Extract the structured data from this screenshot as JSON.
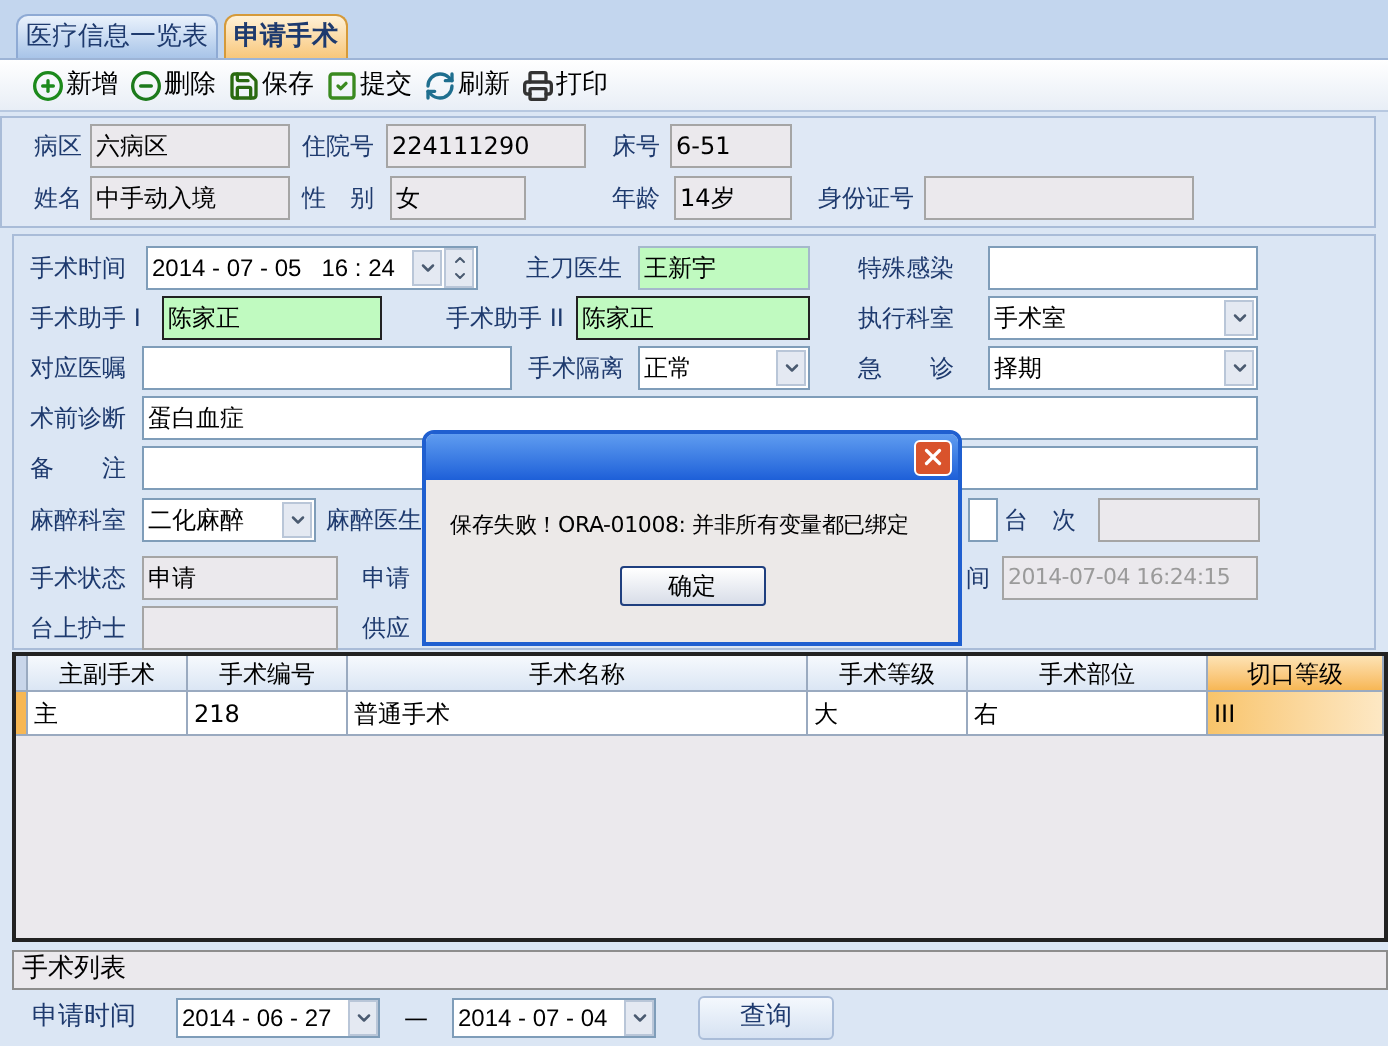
{
  "tabs": [
    {
      "label": "医疗信息一览表",
      "selected": false
    },
    {
      "label": "申请手术",
      "selected": true
    }
  ],
  "toolbar": [
    {
      "kind": "add",
      "label": "新增"
    },
    {
      "kind": "delete",
      "label": "删除"
    },
    {
      "kind": "save",
      "label": "保存"
    },
    {
      "kind": "submit",
      "label": "提交"
    },
    {
      "kind": "refresh",
      "label": "刷新"
    },
    {
      "kind": "print",
      "label": "打印"
    }
  ],
  "patient_info": [
    [
      {
        "kind": "label",
        "text": "病区"
      },
      {
        "kind": "text",
        "value": "六病区",
        "readonly": true
      },
      {
        "kind": "label",
        "text": "住院号"
      },
      {
        "kind": "text",
        "value": "224111290",
        "readonly": true
      },
      {
        "kind": "label",
        "text": "床号"
      },
      {
        "kind": "text",
        "value": "6-51",
        "readonly": true
      }
    ],
    [
      {
        "kind": "label",
        "text": "姓名"
      },
      {
        "kind": "text",
        "value": "中手动入境",
        "readonly": true
      },
      {
        "kind": "label",
        "text": "性　别"
      },
      {
        "kind": "text",
        "value": "女",
        "readonly": true
      },
      {
        "kind": "label",
        "text": "年龄"
      },
      {
        "kind": "text",
        "value": "14岁",
        "readonly": true
      },
      {
        "kind": "label",
        "text": "身份证号"
      },
      {
        "kind": "text",
        "readonly": true
      }
    ]
  ],
  "surgery_form": [
    [
      {
        "kind": "label",
        "text": "手术时间"
      },
      {
        "kind": "datetime",
        "value": "2014 - 07 - 05   16 : 24"
      },
      {
        "kind": "label",
        "text": "主刀医生"
      },
      {
        "kind": "text",
        "value": "王新宇",
        "highlight": true
      },
      {
        "kind": "label",
        "text": "特殊感染"
      },
      {
        "kind": "text"
      }
    ],
    [
      {
        "kind": "label",
        "text": "手术助手 I"
      },
      {
        "kind": "picker",
        "value": "陈家正",
        "highlight": true
      },
      {
        "kind": "label",
        "text": "手术助手 II"
      },
      {
        "kind": "picker",
        "value": "陈家正",
        "highlight": true
      },
      {
        "kind": "label",
        "text": "执行科室"
      },
      {
        "kind": "select",
        "value": "手术室"
      }
    ],
    [
      {
        "kind": "label",
        "text": "对应医嘱"
      },
      {
        "kind": "text"
      },
      {
        "kind": "label",
        "text": "手术隔离"
      },
      {
        "kind": "select",
        "value": "正常"
      },
      {
        "kind": "label",
        "text": "急　　诊"
      },
      {
        "kind": "select",
        "value": "择期"
      }
    ],
    [
      {
        "kind": "label",
        "text": "术前诊断"
      },
      {
        "kind": "text",
        "value": "蛋白血症"
      }
    ],
    [
      {
        "kind": "label",
        "text": "备　　注"
      },
      {
        "kind": "text"
      }
    ],
    [
      {
        "kind": "label",
        "text": "麻醉科室"
      },
      {
        "kind": "select",
        "value": "二化麻醉"
      },
      {
        "kind": "label",
        "text": "麻醉医生"
      },
      {
        "kind": "text"
      },
      {
        "kind": "label",
        "text": "台　次"
      },
      {
        "kind": "text",
        "readonly": true
      }
    ],
    [
      {
        "kind": "label",
        "text": "手术状态"
      },
      {
        "kind": "text",
        "value": "申请",
        "readonly": true
      },
      {
        "kind": "label",
        "text": "申请"
      },
      {
        "kind": "label",
        "text": "间"
      },
      {
        "kind": "text",
        "value": "2014-07-04 16:24:15",
        "readonly": true,
        "disabled": true
      }
    ],
    [
      {
        "kind": "label",
        "text": "台上护士"
      },
      {
        "kind": "text",
        "readonly": true
      },
      {
        "kind": "label",
        "text": "供应"
      }
    ]
  ],
  "table": {
    "columns": [
      {
        "label": "主副手术",
        "selected": false
      },
      {
        "label": "手术编号",
        "selected": false
      },
      {
        "label": "手术名称",
        "selected": false
      },
      {
        "label": "手术等级",
        "selected": false
      },
      {
        "label": "手术部位",
        "selected": false
      },
      {
        "label": "切口等级",
        "selected": true
      }
    ],
    "rows": [
      {
        "selected": true,
        "cells": [
          "主",
          "218",
          "普通手术",
          "大",
          "右",
          "III"
        ]
      }
    ]
  },
  "list_title": "手术列表",
  "query": {
    "label": "申请时间",
    "from": "2014 - 06 - 27",
    "separator": "—",
    "to": "2014 - 07 - 04",
    "button": "查询"
  },
  "dialog": {
    "message": "保存失败！ORA-01008: 并非所有变量都已绑定",
    "button": "确定"
  }
}
